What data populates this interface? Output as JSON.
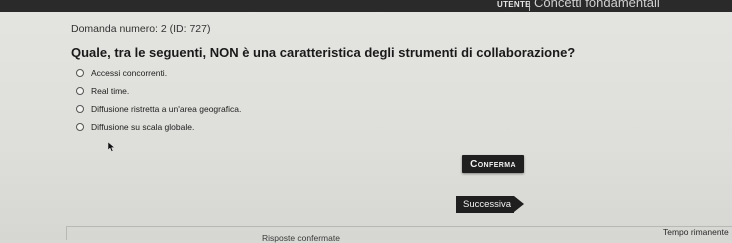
{
  "header": {
    "brand": "UTENTE",
    "section": "Concetti fondamentali"
  },
  "question": {
    "number_label": "Domanda numero: 2 (ID: 727)",
    "text": "Quale, tra le seguenti, NON è una caratteristica degli strumenti di collaborazione?"
  },
  "options": [
    {
      "label": "Accessi concorrenti."
    },
    {
      "label": "Real time."
    },
    {
      "label": "Diffusione ristretta a un'area geografica."
    },
    {
      "label": "Diffusione su scala globale."
    }
  ],
  "actions": {
    "confirm_label": "Conferma",
    "next_label": "Successiva"
  },
  "footer": {
    "confirmed_answers_label": "Risposte confermate",
    "time_remaining_label": "Tempo rimanente"
  }
}
